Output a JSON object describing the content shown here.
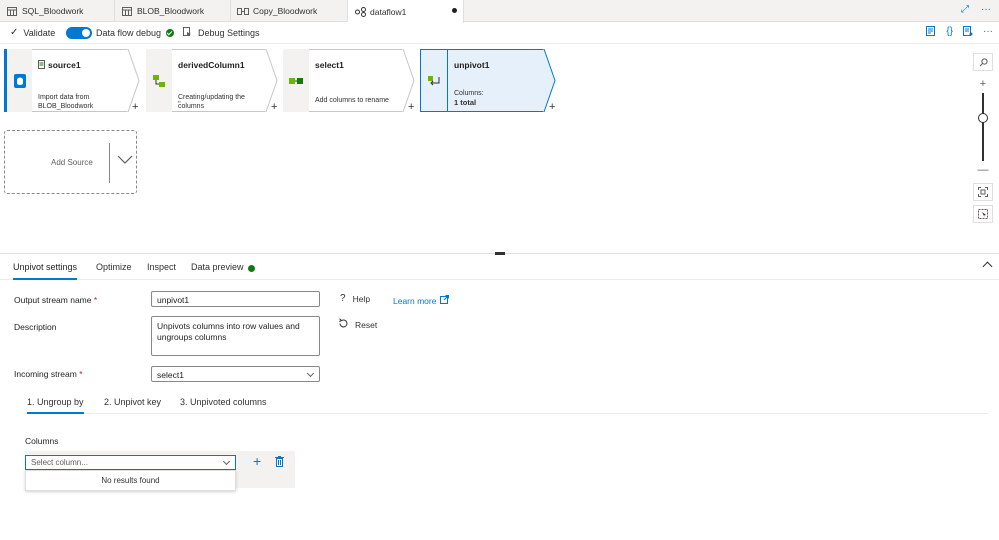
{
  "tabs": [
    {
      "label": "SQL_Bloodwork",
      "icon": "table-icon"
    },
    {
      "label": "BLOB_Bloodwork",
      "icon": "table-icon"
    },
    {
      "label": "Copy_Bloodwork",
      "icon": "pipeline-icon"
    },
    {
      "label": "dataflow1",
      "icon": "dataflow-icon",
      "active": true,
      "dirty": true
    }
  ],
  "toolbar": {
    "validate_label": "Validate",
    "debug_label": "Data flow debug",
    "debug_on": true,
    "debug_settings_label": "Debug Settings"
  },
  "flow": {
    "nodes": [
      {
        "title": "source1",
        "desc": "Import data from BLOB_Bloodwork"
      },
      {
        "title": "derivedColumn1",
        "desc": "Creating/updating the columns",
        "desc2": "''"
      },
      {
        "title": "select1",
        "desc": "Add columns to rename"
      },
      {
        "title": "unpivot1",
        "desc": "Columns:",
        "value": "1 total",
        "selected": true
      }
    ],
    "add_source_label": "Add Source",
    "accent": "#0078d4"
  },
  "panel": {
    "tabs": [
      "Unpivot settings",
      "Optimize",
      "Inspect",
      "Data preview"
    ],
    "active_tab": "Unpivot settings",
    "output_stream_label": "Output stream name",
    "output_stream_value": "unpivot1",
    "description_label": "Description",
    "description_value": "Unpivots columns into row values and ungroups columns",
    "incoming_stream_label": "Incoming stream",
    "incoming_stream_value": "select1",
    "help_label": "Help",
    "learn_more_label": "Learn more",
    "reset_label": "Reset",
    "subtabs": [
      "1. Ungroup by",
      "2. Unpivot key",
      "3. Unpivoted columns"
    ],
    "columns_label": "Columns",
    "column_placeholder": "Select column...",
    "no_results": "No results found"
  }
}
